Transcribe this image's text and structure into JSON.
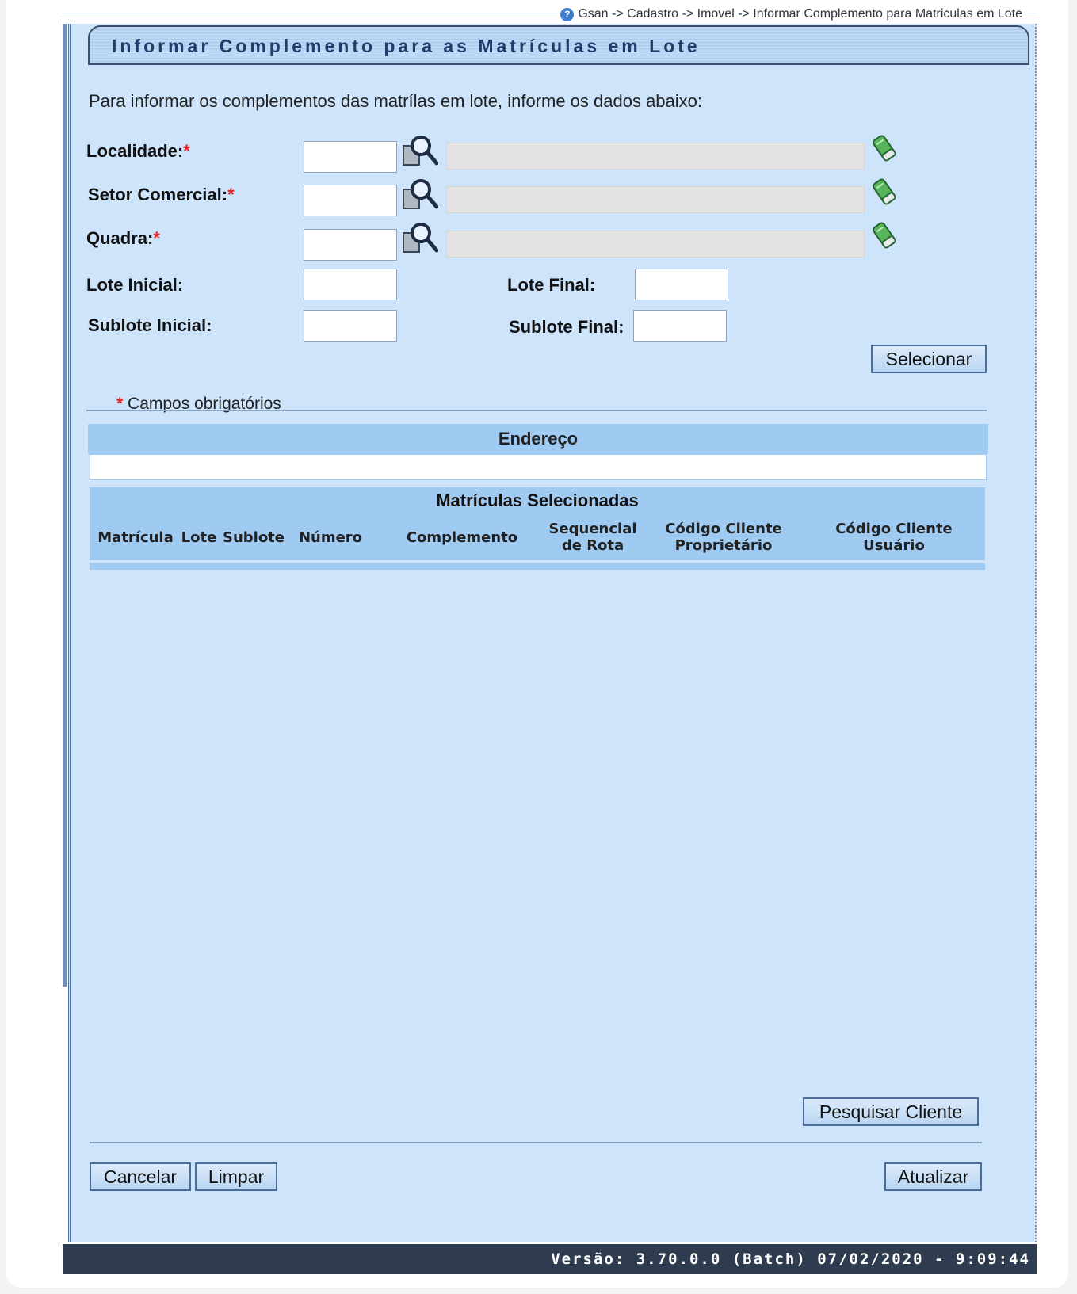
{
  "breadcrumb": {
    "text": "Gsan -> Cadastro -> Imovel -> Informar Complemento para Matriculas em Lote",
    "help_icon": "?"
  },
  "title": "Informar Complemento para as Matrículas em Lote",
  "intro": "Para informar os complementos das matrílas em lote, informe os dados abaixo:",
  "fields": {
    "localidade": {
      "label": "Localidade:",
      "required_mark": "*",
      "value": "",
      "description": ""
    },
    "setor": {
      "label": "Setor Comercial:",
      "required_mark": "*",
      "value": "",
      "description": ""
    },
    "quadra": {
      "label": "Quadra:",
      "required_mark": "*",
      "value": "",
      "description": ""
    },
    "lote_inicial": {
      "label": "Lote Inicial:",
      "value": ""
    },
    "lote_final": {
      "label": "Lote Final:",
      "value": ""
    },
    "sublote_inicial": {
      "label": "Sublote Inicial:",
      "value": ""
    },
    "sublote_final": {
      "label": "Sublote Final:",
      "value": ""
    }
  },
  "buttons": {
    "selecionar": "Selecionar",
    "pesquisar_cliente": "Pesquisar Cliente",
    "cancelar": "Cancelar",
    "limpar": "Limpar",
    "atualizar": "Atualizar"
  },
  "required_note": {
    "mark": "*",
    "text": "Campos obrigatórios"
  },
  "endereco": {
    "header": "Endereço",
    "value": ""
  },
  "matriculas": {
    "header": "Matrículas Selecionadas",
    "columns": [
      "Matrícula",
      "Lote",
      "Sublote",
      "Número",
      "Complemento",
      "Sequencial de Rota",
      "Código Cliente Proprietário",
      "Código Cliente Usuário"
    ],
    "rows": []
  },
  "footer": "Versão: 3.70.0.0 (Batch) 07/02/2020 - 9:09:44",
  "icons": {
    "lookup": "magnifier-icon",
    "clear": "eraser-icon",
    "help": "help-icon"
  },
  "colors": {
    "panel": "#cde4fa",
    "header_band": "#9fcbf3",
    "footer": "#2f3b4f",
    "required": "#dd2222"
  }
}
